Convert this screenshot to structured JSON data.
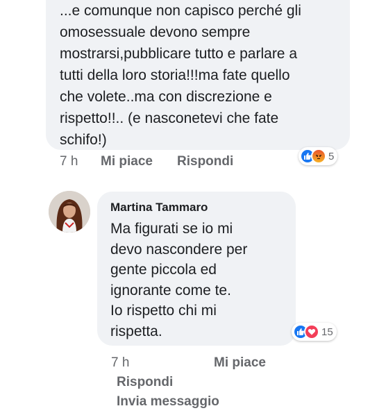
{
  "comment1": {
    "text": "...e comunque non capisco perché gli\nomosessuale devono sempre\nmostrarsi,pubblicare tutto e parlare a\ntutti della loro storia!!!ma fate quello\nche volete..ma con discrezione e\nrispetto!!.. (e nasconetevi che fate\nschifo!)",
    "time": "7 h",
    "like_label": "Mi piace",
    "reply_label": "Rispondi",
    "reactions": [
      "like-icon",
      "angry-icon"
    ],
    "reaction_count": "5"
  },
  "comment2": {
    "author": "Martina Tammaro",
    "text": "Ma figurati se io mi\ndevo nascondere per\ngente piccola ed\nignorante come te.\nIo rispetto chi mi\nrispetta.",
    "time": "7 h",
    "like_label": "Mi piace",
    "reply_label": "Rispondi",
    "message_label": "Invia messaggio",
    "reactions": [
      "like-icon",
      "love-icon"
    ],
    "reaction_count": "15"
  },
  "colors": {
    "bubble_bg": "#f0f2f5",
    "meta_text": "#65676b",
    "like_blue": "#1877f2",
    "love_red": "#f33e58"
  }
}
